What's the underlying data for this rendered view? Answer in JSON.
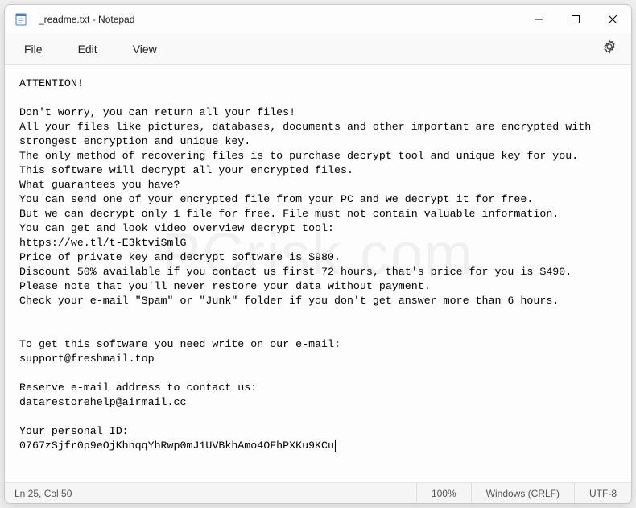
{
  "titlebar": {
    "icon_name": "notepad-icon",
    "title": "_readme.txt - Notepad"
  },
  "menu": {
    "file": "File",
    "edit": "Edit",
    "view": "View"
  },
  "content": {
    "l1": "ATTENTION!",
    "l2": "",
    "l3": "Don't worry, you can return all your files!",
    "l4": "All your files like pictures, databases, documents and other important are encrypted with strongest encryption and unique key.",
    "l5": "The only method of recovering files is to purchase decrypt tool and unique key for you.",
    "l6": "This software will decrypt all your encrypted files.",
    "l7": "What guarantees you have?",
    "l8": "You can send one of your encrypted file from your PC and we decrypt it for free.",
    "l9": "But we can decrypt only 1 file for free. File must not contain valuable information.",
    "l10": "You can get and look video overview decrypt tool:",
    "l11": "https://we.tl/t-E3ktviSmlG",
    "l12": "Price of private key and decrypt software is $980.",
    "l13": "Discount 50% available if you contact us first 72 hours, that's price for you is $490.",
    "l14": "Please note that you'll never restore your data without payment.",
    "l15": "Check your e-mail \"Spam\" or \"Junk\" folder if you don't get answer more than 6 hours.",
    "l16": "",
    "l17": "",
    "l18": "To get this software you need write on our e-mail:",
    "l19": "support@freshmail.top",
    "l20": "",
    "l21": "Reserve e-mail address to contact us:",
    "l22": "datarestorehelp@airmail.cc",
    "l23": "",
    "l24": "Your personal ID:",
    "l25": "0767zSjfr0p9eOjKhnqqYhRwp0mJ1UVBkhAmo4OFhPXKu9KCu"
  },
  "statusbar": {
    "pos": "Ln 25, Col 50",
    "zoom": "100%",
    "eol": "Windows (CRLF)",
    "encoding": "UTF-8"
  }
}
